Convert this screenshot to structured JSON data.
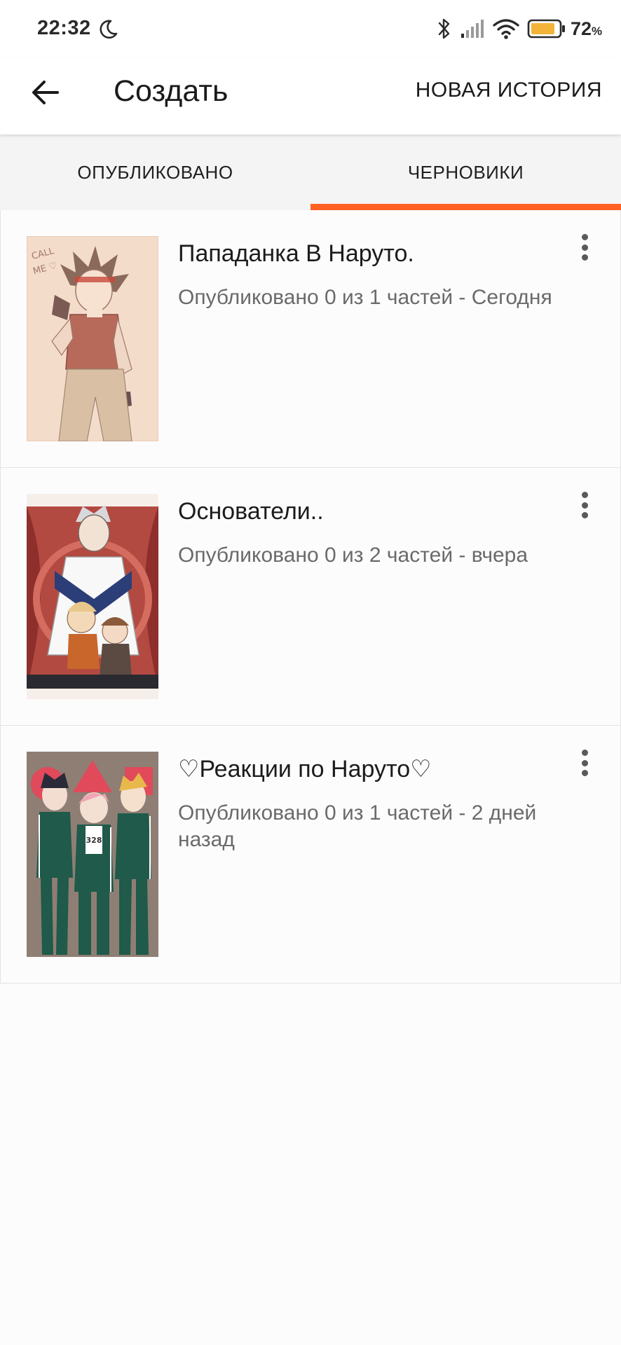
{
  "status_bar": {
    "time": "22:32",
    "battery_percent": "72",
    "battery_unit": "%",
    "battery_color": "#f2b33a",
    "icons": [
      "moon-icon",
      "bluetooth-icon",
      "signal-icon",
      "wifi-icon",
      "battery-icon"
    ]
  },
  "app_bar": {
    "title": "Создать",
    "new_story_label": "НОВАЯ ИСТОРИЯ",
    "back_icon": "arrow-left-icon"
  },
  "tabs": [
    {
      "label": "ОПУБЛИКОВАНО",
      "selected": false
    },
    {
      "label": "ЧЕРНОВИКИ",
      "selected": true
    }
  ],
  "accent_color": "#ff6122",
  "stories": [
    {
      "title": "Пападанка В Наруто.",
      "meta": "Опубликовано 0 из 1 частей - Сегодня",
      "cover_text": "CALL ME"
    },
    {
      "title": "Основатели..",
      "meta": "Опубликовано 0 из 2 частей - вчера"
    },
    {
      "title": "♡Реакции по Наруто♡",
      "meta": "Опубликовано 0 из 1 частей - 2 дней назад",
      "cover_text": "328"
    }
  ]
}
